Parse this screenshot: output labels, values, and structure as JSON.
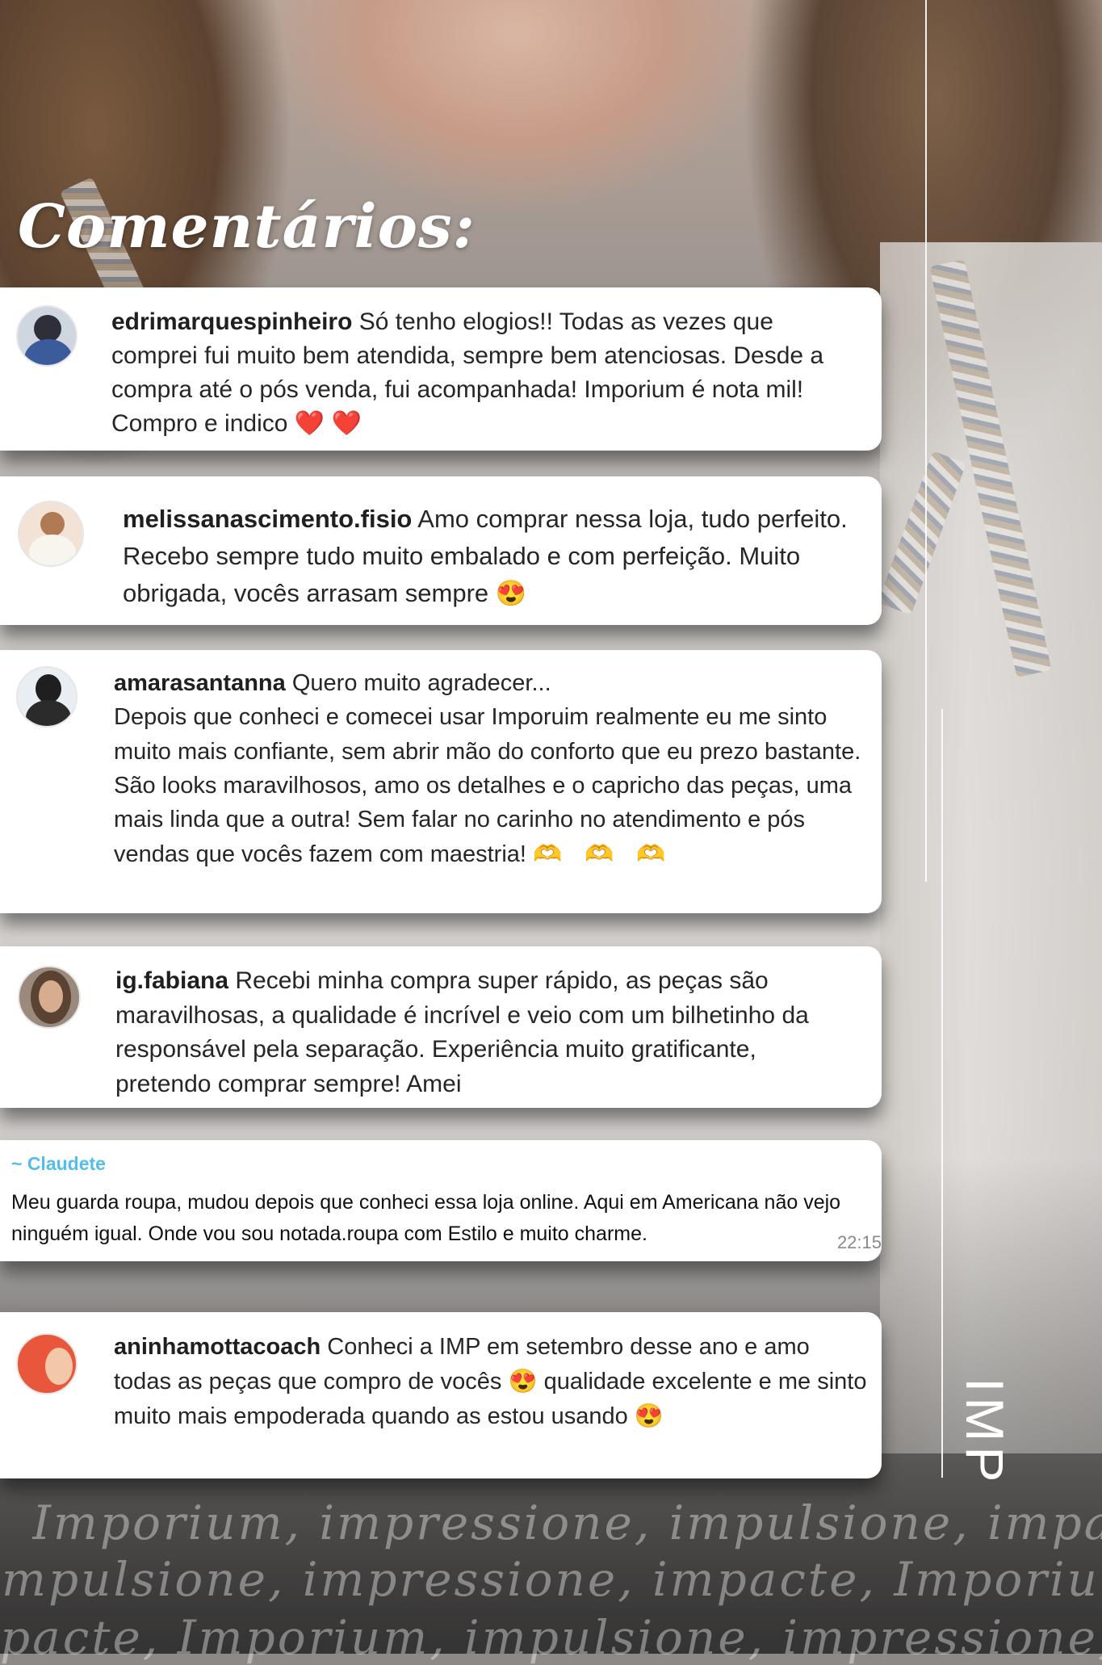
{
  "heading": "Comentários:",
  "comments": [
    {
      "username": "edrimarquespinheiro",
      "text": "Só tenho elogios!! Todas as vezes que comprei fui muito bem atendida, sempre bem atenciosas. Desde a compra até o pós venda, fui acompanhada! Imporium é nota mil! Compro e indico",
      "emoji": "❤️ ❤️"
    },
    {
      "username": "melissanascimento.fisio",
      "text": "Amo comprar nessa loja, tudo perfeito. Recebo sempre tudo muito embalado e com perfeição. Muito obrigada, vocês arrasam sempre",
      "emoji": "😍"
    },
    {
      "username": "amarasantanna",
      "text_first": "Quero muito agradecer...",
      "text": "Depois que conheci e comecei usar Imporuim realmente eu me sinto muito mais confiante, sem abrir mão do conforto que eu prezo bastante. São looks maravilhosos, amo os detalhes e o capricho das peças, uma mais linda que a outra! Sem falar no carinho no atendimento e pós vendas que vocês fazem com maestria!",
      "emoji": "🫶 🫶 🫶"
    },
    {
      "username": "ig.fabiana",
      "text": "Recebi minha compra super rápido, as peças são maravilhosas, a qualidade é incrível e veio com um bilhetinho da responsável pela separação. Experiência muito gratificante, pretendo comprar sempre! Amei"
    }
  ],
  "whatsapp": {
    "sender": "~ Claudete",
    "text": "Meu guarda roupa, mudou depois que conheci essa loja online. Aqui em Americana não vejo ninguém igual. Onde vou sou notada.roupa com Estilo e muito charme.",
    "time": "22:15"
  },
  "last_comment": {
    "username": "aninhamottacoach",
    "text_a": "Conheci a IMP em setembro desse ano e amo todas as peças que compro de vocês",
    "emoji_a": "😍",
    "text_b": "qualidade excelente e me sinto muito mais empoderada quando as estou usando",
    "emoji_b": "😍"
  },
  "logo": "IMP",
  "watermark": [
    "Imporium, impressione, impulsione, impacte,",
    "mpulsione, impressione, impacte, Imporium,",
    "pacte, Imporium, impulsione, impressione, I"
  ],
  "colors": {
    "card_bg": "#ffffff",
    "text": "#262626",
    "heart": "#ee2e5e",
    "whatsapp_name": "#53bdeb",
    "timestamp": "#8a8a8a"
  }
}
